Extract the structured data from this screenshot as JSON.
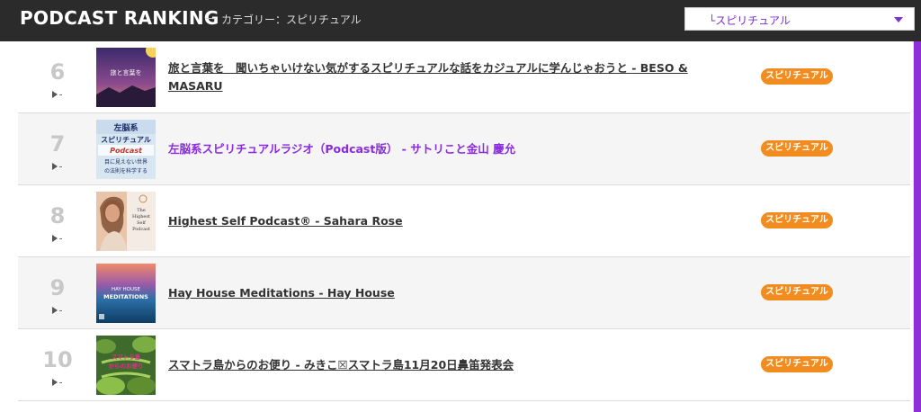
{
  "header": {
    "title": "PODCAST RANKING",
    "separator": "—",
    "category_label": "カテゴリー：スピリチュアル"
  },
  "category_select": {
    "selected": "└スピリチュアル"
  },
  "colors": {
    "header_bg": "#2b2b2b",
    "accent_purple": "#8a2be2",
    "badge_orange": "#f28c1e"
  },
  "items": [
    {
      "rank": "6",
      "title": "旅と言葉を　聞いちゃいけない気がするスピリチュアルな話をカジュアルに学んじゃおうと - BESO & MASARU",
      "badge": "スピリチュアル",
      "thumb_text": "旅と言葉を"
    },
    {
      "rank": "7",
      "title": "左脳系スピリチュアルラジオ（Podcast版） - サトリこと金山 慶允",
      "badge": "スピリチュアル",
      "thumb_text": "左脳系スピリチュアル"
    },
    {
      "rank": "8",
      "title": "Highest Self Podcast® - Sahara Rose",
      "badge": "スピリチュアル",
      "thumb_text": "The Highest Self Podcast"
    },
    {
      "rank": "9",
      "title": "Hay House Meditations - Hay House",
      "badge": "スピリチュアル",
      "thumb_text": "HAY HOUSE MEDITATIONS"
    },
    {
      "rank": "10",
      "title": "スマトラ島からのお便り - みきこ☒スマトラ島11月20日鼻笛発表会",
      "badge": "スピリチュアル",
      "thumb_text": "スマトラ島からのお便り"
    }
  ]
}
